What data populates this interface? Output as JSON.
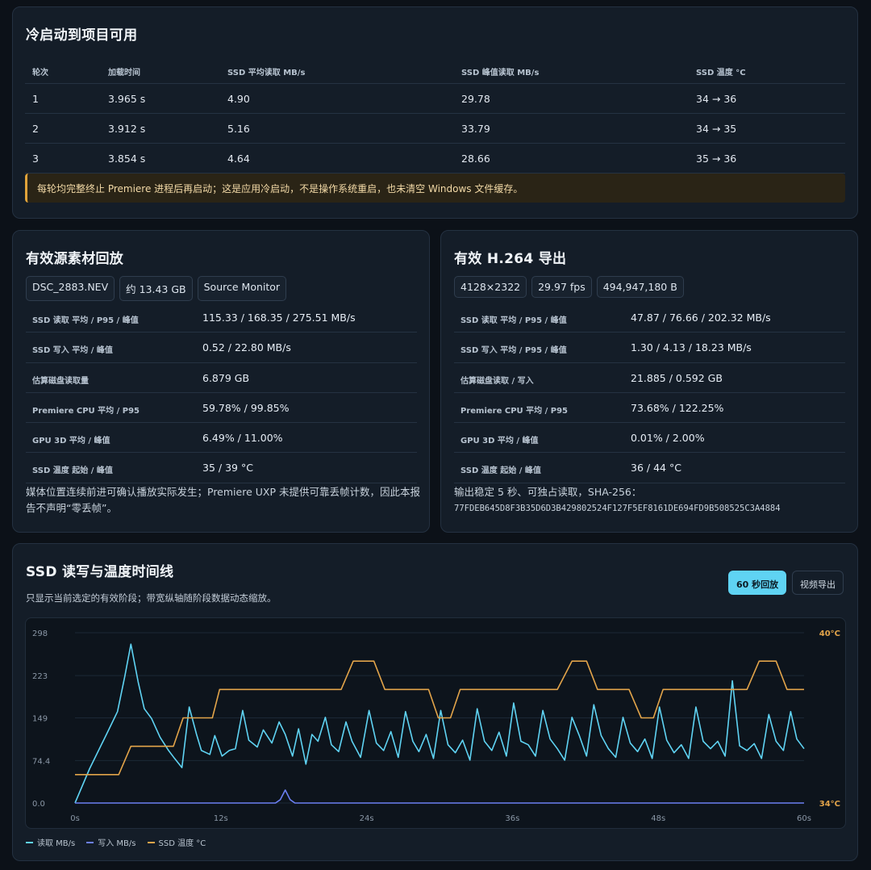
{
  "cold_start": {
    "title": "冷启动到项目可用",
    "headers": [
      "轮次",
      "加载时间",
      "SSD 平均读取 MB/s",
      "SSD 峰值读取 MB/s",
      "SSD 温度 °C"
    ],
    "rows": [
      [
        "1",
        "3.965 s",
        "4.90",
        "29.78",
        "34 → 36"
      ],
      [
        "2",
        "3.912 s",
        "5.16",
        "33.79",
        "34 → 35"
      ],
      [
        "3",
        "3.854 s",
        "4.64",
        "28.66",
        "35 → 36"
      ]
    ],
    "note": "每轮均完整终止 Premiere 进程后再启动；这是应用冷启动，不是操作系统重启，也未清空 Windows 文件缓存。"
  },
  "playback": {
    "title": "有效源素材回放",
    "chips": [
      "DSC_2883.NEV",
      "约 13.43 GB",
      "Source Monitor"
    ],
    "rows": [
      {
        "label": "SSD 读取 平均 / P95 / 峰值",
        "value": "115.33 / 168.35 / 275.51 MB/s"
      },
      {
        "label": "SSD 写入 平均 / 峰值",
        "value": "0.52 / 22.80 MB/s"
      },
      {
        "label": "估算磁盘读取量",
        "value": "6.879 GB"
      },
      {
        "label": "Premiere CPU 平均 / P95",
        "value": "59.78% / 99.85%"
      },
      {
        "label": "GPU 3D 平均 / 峰值",
        "value": "6.49% / 11.00%"
      },
      {
        "label": "SSD 温度 起始 / 峰值",
        "value": "35 / 39 °C"
      }
    ],
    "footer_line1": "媒体位置连续前进可确认播放实际发生；Premiere UXP 未提供可靠丢帧计数，因此本报",
    "footer_line2": "告不声明“零丢帧”。"
  },
  "export": {
    "title": "有效 H.264 导出",
    "chips": [
      "4128×2322",
      "29.97 fps",
      "494,947,180 B"
    ],
    "rows": [
      {
        "label": "SSD 读取 平均 / P95 / 峰值",
        "value": "47.87 / 76.66 / 202.32 MB/s"
      },
      {
        "label": "SSD 写入 平均 / P95 / 峰值",
        "value": "1.30 / 4.13 / 18.23 MB/s"
      },
      {
        "label": "估算磁盘读取 / 写入",
        "value": "21.885 / 0.592 GB"
      },
      {
        "label": "Premiere CPU 平均 / P95",
        "value": "73.68% / 122.25%"
      },
      {
        "label": "GPU 3D 平均 / 峰值",
        "value": "0.01% / 2.00%"
      },
      {
        "label": "SSD 温度 起始 / 峰值",
        "value": "36 / 44 °C"
      }
    ],
    "footer_line1": "输出稳定 5 秒、可独占读取，SHA-256：",
    "footer_hash": "77FDEB645D8F3B35D6D3B429802524F127F5EF8161DE694FD9B508525C3A4884"
  },
  "timeline": {
    "title": "SSD 读写与温度时间线",
    "subtitle": "只显示当前选定的有效阶段；带宽纵轴随阶段数据动态缩放。",
    "tabs": [
      {
        "label": "60 秒回放",
        "active": true
      },
      {
        "label": "视频导出",
        "active": false
      }
    ],
    "legend": [
      {
        "label": "读取 MB/s",
        "color": "#5fd3f3"
      },
      {
        "label": "写入 MB/s",
        "color": "#6b7ff2"
      },
      {
        "label": "SSD 温度 °C",
        "color": "#e2a44a"
      }
    ]
  },
  "chart_data": {
    "type": "line",
    "x_ticks": [
      0,
      12,
      24,
      36,
      48,
      60
    ],
    "x_tick_labels": [
      "0s",
      "12s",
      "24s",
      "36s",
      "48s",
      "60s"
    ],
    "xlim": [
      0,
      60
    ],
    "y_ticks": [
      0.0,
      74.4,
      149,
      223,
      298
    ],
    "y_tick_labels": [
      "0.0",
      "74.4",
      "149",
      "223",
      "298"
    ],
    "ylim": [
      0,
      298
    ],
    "y2_labels": [
      "40°C",
      "34°C"
    ],
    "y2lim": [
      34,
      40
    ],
    "grid": true,
    "series": [
      {
        "name": "读取 MB/s",
        "color": "#5fd3f3",
        "axis": "left",
        "points": [
          [
            0,
            0
          ],
          [
            1.2,
            60
          ],
          [
            2.7,
            125
          ],
          [
            3.5,
            160
          ],
          [
            4.1,
            222
          ],
          [
            4.6,
            278
          ],
          [
            5.2,
            212
          ],
          [
            5.7,
            165
          ],
          [
            6.3,
            148
          ],
          [
            7.0,
            115
          ],
          [
            7.7,
            92
          ],
          [
            8.2,
            78
          ],
          [
            8.8,
            62
          ],
          [
            9.4,
            168
          ],
          [
            10.0,
            120
          ],
          [
            10.4,
            92
          ],
          [
            11.1,
            85
          ],
          [
            11.5,
            118
          ],
          [
            12.1,
            82
          ],
          [
            12.7,
            92
          ],
          [
            13.2,
            95
          ],
          [
            13.8,
            162
          ],
          [
            14.3,
            110
          ],
          [
            15.0,
            98
          ],
          [
            15.5,
            128
          ],
          [
            16.2,
            105
          ],
          [
            16.8,
            142
          ],
          [
            17.3,
            120
          ],
          [
            17.9,
            82
          ],
          [
            18.4,
            130
          ],
          [
            19.0,
            68
          ],
          [
            19.5,
            120
          ],
          [
            20.0,
            108
          ],
          [
            20.6,
            150
          ],
          [
            21.1,
            102
          ],
          [
            21.7,
            90
          ],
          [
            22.3,
            142
          ],
          [
            22.8,
            108
          ],
          [
            23.5,
            80
          ],
          [
            24.2,
            162
          ],
          [
            24.8,
            105
          ],
          [
            25.4,
            92
          ],
          [
            26.0,
            125
          ],
          [
            26.6,
            80
          ],
          [
            27.2,
            160
          ],
          [
            27.8,
            108
          ],
          [
            28.3,
            90
          ],
          [
            28.9,
            120
          ],
          [
            29.5,
            78
          ],
          [
            30.1,
            162
          ],
          [
            30.7,
            102
          ],
          [
            31.3,
            88
          ],
          [
            31.9,
            110
          ],
          [
            32.5,
            75
          ],
          [
            33.1,
            165
          ],
          [
            33.7,
            108
          ],
          [
            34.3,
            92
          ],
          [
            34.9,
            124
          ],
          [
            35.5,
            82
          ],
          [
            36.1,
            175
          ],
          [
            36.7,
            108
          ],
          [
            37.3,
            102
          ],
          [
            37.9,
            82
          ],
          [
            38.5,
            162
          ],
          [
            39.1,
            112
          ],
          [
            39.7,
            95
          ],
          [
            40.3,
            75
          ],
          [
            40.9,
            150
          ],
          [
            41.5,
            118
          ],
          [
            42.1,
            82
          ],
          [
            42.7,
            172
          ],
          [
            43.3,
            118
          ],
          [
            43.9,
            95
          ],
          [
            44.5,
            80
          ],
          [
            45.1,
            150
          ],
          [
            45.7,
            105
          ],
          [
            46.3,
            90
          ],
          [
            46.9,
            112
          ],
          [
            47.5,
            78
          ],
          [
            48.1,
            168
          ],
          [
            48.7,
            110
          ],
          [
            49.3,
            88
          ],
          [
            49.9,
            102
          ],
          [
            50.5,
            78
          ],
          [
            51.1,
            168
          ],
          [
            51.7,
            108
          ],
          [
            52.3,
            95
          ],
          [
            52.9,
            108
          ],
          [
            53.5,
            82
          ],
          [
            54.1,
            214
          ],
          [
            54.7,
            100
          ],
          [
            55.3,
            92
          ],
          [
            55.9,
            104
          ],
          [
            56.5,
            78
          ],
          [
            57.1,
            155
          ],
          [
            57.7,
            108
          ],
          [
            58.3,
            92
          ],
          [
            58.9,
            160
          ],
          [
            59.4,
            112
          ],
          [
            60.0,
            95
          ]
        ]
      },
      {
        "name": "写入 MB/s",
        "color": "#6b7ff2",
        "axis": "left",
        "points": [
          [
            0,
            0
          ],
          [
            16.5,
            0
          ],
          [
            16.9,
            6
          ],
          [
            17.3,
            22.8
          ],
          [
            17.7,
            6
          ],
          [
            18.1,
            0
          ],
          [
            60,
            0
          ]
        ]
      },
      {
        "name": "SSD 温度 °C",
        "color": "#e2a44a",
        "axis": "right",
        "points": [
          [
            0,
            35
          ],
          [
            3.6,
            35
          ],
          [
            4.6,
            36
          ],
          [
            8.1,
            36
          ],
          [
            8.9,
            37
          ],
          [
            11.3,
            37
          ],
          [
            11.9,
            38
          ],
          [
            16.4,
            38
          ],
          [
            17.3,
            38
          ],
          [
            21.9,
            38
          ],
          [
            22.9,
            39
          ],
          [
            24.6,
            39
          ],
          [
            25.5,
            38
          ],
          [
            29.1,
            38
          ],
          [
            29.9,
            37
          ],
          [
            30.9,
            37
          ],
          [
            31.7,
            38
          ],
          [
            39.7,
            38
          ],
          [
            40.9,
            39
          ],
          [
            42.1,
            39
          ],
          [
            43.0,
            38
          ],
          [
            45.6,
            38
          ],
          [
            46.6,
            37
          ],
          [
            47.6,
            37
          ],
          [
            48.4,
            38
          ],
          [
            55.3,
            38
          ],
          [
            56.3,
            39
          ],
          [
            57.7,
            39
          ],
          [
            58.6,
            38
          ],
          [
            60,
            38
          ]
        ]
      }
    ]
  }
}
